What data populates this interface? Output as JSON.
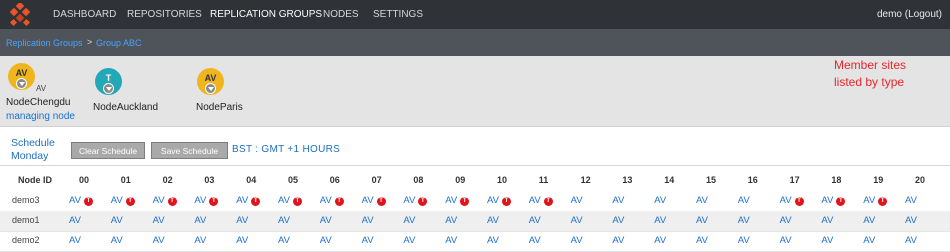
{
  "nav": {
    "items": [
      "DASHBOARD",
      "REPOSITORIES",
      "REPLICATION GROUPS",
      "NODES",
      "SETTINGS"
    ],
    "active": "REPLICATION GROUPS",
    "user": "demo (Logout)"
  },
  "breadcrumb": [
    "Replication Groups",
    "> ",
    "Group ABC"
  ],
  "members": {
    "annotation_line1": "Member sites",
    "annotation_line2": "listed by type",
    "nodes": [
      {
        "badge": "AV",
        "type_label": "AV",
        "name": "NodeChengdu",
        "sub": "managing node",
        "color": "#f0b51c",
        "text_color": "#333333"
      },
      {
        "badge": "T",
        "name": "NodeAuckland",
        "color": "#23a8b8",
        "text_color": "#ffffff"
      },
      {
        "badge": "AV",
        "name": "NodeParis",
        "color": "#f0b51c",
        "text_color": "#333333"
      }
    ]
  },
  "schedule": {
    "label_line1": "Schedule",
    "label_line2": "Monday",
    "clear_button": "Clear Schedule",
    "save_button": "Save Schedule",
    "timezone": "BST : GMT +1 HOURS"
  },
  "table": {
    "header_id": "Node ID",
    "hours": [
      "00",
      "01",
      "02",
      "03",
      "04",
      "05",
      "06",
      "07",
      "08",
      "09",
      "10",
      "11",
      "12",
      "13",
      "14",
      "15",
      "16",
      "17",
      "18",
      "19",
      "20"
    ],
    "rows": [
      {
        "id": "demo3",
        "cell": "AV",
        "badge": "T",
        "badge_hours": [
          "00",
          "01",
          "02",
          "03",
          "04",
          "05",
          "06",
          "07",
          "08",
          "09",
          "10",
          "11",
          "17",
          "18",
          "19"
        ]
      },
      {
        "id": "demo1",
        "cell": "AV",
        "badge": "",
        "badge_hours": []
      },
      {
        "id": "demo2",
        "cell": "AV",
        "badge": "",
        "badge_hours": []
      }
    ]
  },
  "colors": {
    "accent": "#1f6fd0",
    "badge_red": "#e0141c",
    "annotation": "#e8272b"
  }
}
